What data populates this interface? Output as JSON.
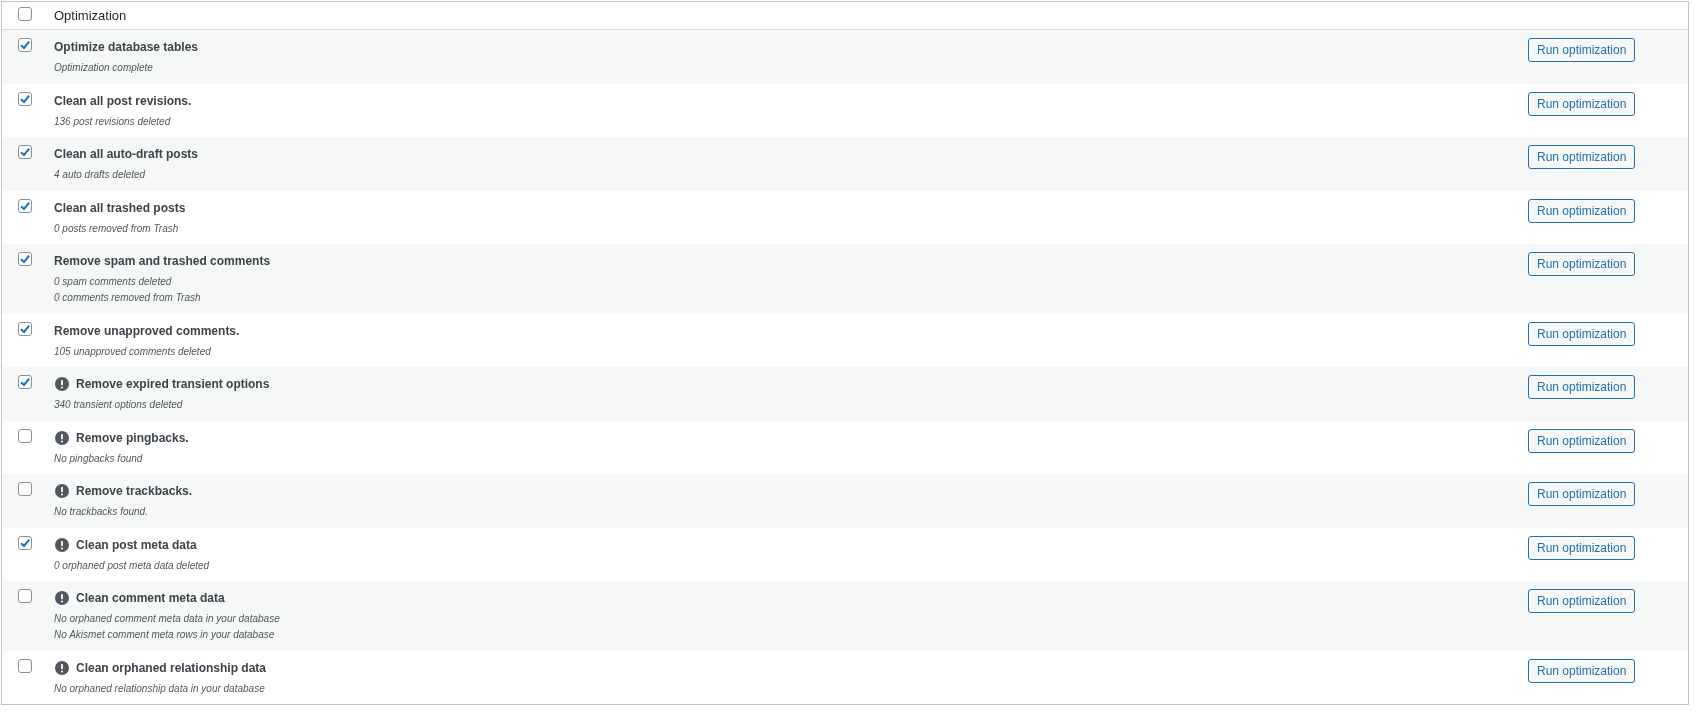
{
  "header": {
    "select_all_checked": false,
    "label": "Optimization"
  },
  "rows": [
    {
      "checked": true,
      "alert": false,
      "title": "Optimize database tables",
      "details": [
        "Optimization complete"
      ],
      "button": "Run optimization"
    },
    {
      "checked": true,
      "alert": false,
      "title": "Clean all post revisions.",
      "details": [
        "136 post revisions deleted"
      ],
      "button": "Run optimization"
    },
    {
      "checked": true,
      "alert": false,
      "title": "Clean all auto-draft posts",
      "details": [
        "4 auto drafts deleted"
      ],
      "button": "Run optimization"
    },
    {
      "checked": true,
      "alert": false,
      "title": "Clean all trashed posts",
      "details": [
        "0 posts removed from Trash"
      ],
      "button": "Run optimization"
    },
    {
      "checked": true,
      "alert": false,
      "title": "Remove spam and trashed comments",
      "details": [
        "0 spam comments deleted",
        "0 comments removed from Trash"
      ],
      "button": "Run optimization"
    },
    {
      "checked": true,
      "alert": false,
      "title": "Remove unapproved comments.",
      "details": [
        "105 unapproved comments deleted"
      ],
      "button": "Run optimization"
    },
    {
      "checked": true,
      "alert": true,
      "title": "Remove expired transient options",
      "details": [
        "340 transient options deleted"
      ],
      "button": "Run optimization"
    },
    {
      "checked": false,
      "alert": true,
      "title": "Remove pingbacks.",
      "details": [
        "No pingbacks found"
      ],
      "button": "Run optimization"
    },
    {
      "checked": false,
      "alert": true,
      "title": "Remove trackbacks.",
      "details": [
        "No trackbacks found."
      ],
      "button": "Run optimization"
    },
    {
      "checked": true,
      "alert": true,
      "title": "Clean post meta data",
      "details": [
        "0 orphaned post meta data deleted"
      ],
      "button": "Run optimization"
    },
    {
      "checked": false,
      "alert": true,
      "title": "Clean comment meta data",
      "details": [
        "No orphaned comment meta data in your database",
        "No Akismet comment meta rows in your database"
      ],
      "button": "Run optimization"
    },
    {
      "checked": false,
      "alert": true,
      "title": "Clean orphaned relationship data",
      "details": [
        "No orphaned relationship data in your database"
      ],
      "button": "Run optimization"
    }
  ]
}
